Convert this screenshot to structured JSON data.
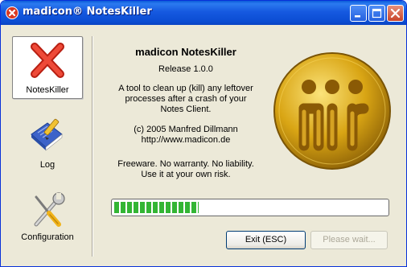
{
  "window": {
    "title": "madicon® NotesKiller"
  },
  "sidebar": {
    "items": [
      {
        "label": "NotesKiller",
        "icon": "red-x-icon",
        "selected": true
      },
      {
        "label": "Log",
        "icon": "log-book-icon",
        "selected": false
      },
      {
        "label": "Configuration",
        "icon": "tools-icon",
        "selected": false
      }
    ]
  },
  "about": {
    "app_name": "madicon NotesKiller",
    "release": "Release 1.0.0",
    "description_line1": "A tool to clean up (kill) any leftover",
    "description_line2": "processes after a crash of your",
    "description_line3": "Notes Client.",
    "copyright": "(c) 2005 Manfred Dillmann",
    "website": "http://www.madicon.de",
    "disclaimer_line1": "Freeware. No warranty. No liability.",
    "disclaimer_line2": "Use it at your own risk."
  },
  "progress": {
    "value": 0.31
  },
  "buttons": {
    "exit_label": "Exit (ESC)",
    "wait_label": "Please wait..."
  },
  "colors": {
    "titlebar": "#0b52d9",
    "progress_fill": "#33b534",
    "logo_gold": "#d9a514"
  }
}
